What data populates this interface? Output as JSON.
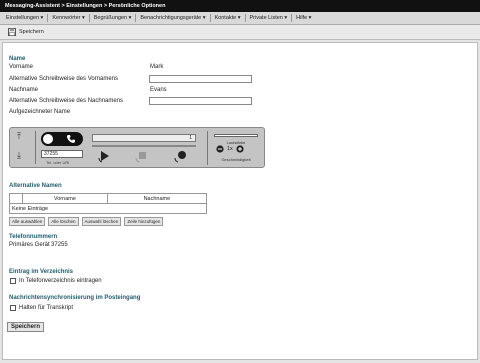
{
  "window": {
    "title": "Messaging-Assistent > Einstellungen > Persönliche Optionen"
  },
  "menu": [
    "Einstellungen ▾",
    "Kennwörter ▾",
    "Begrüßungen ▾",
    "Benachrichtigungsgeräte ▾",
    "Kontakte ▾",
    "Private Listen ▾",
    "Hilfe ▾"
  ],
  "toolbar": {
    "save_label": "Speichern"
  },
  "name_section": {
    "title": "Name",
    "first_name_label": "Vorname",
    "first_name_value": "Mark",
    "alt_first_label": "Alternative Schreibweise des Vornamens",
    "last_name_label": "Nachname",
    "last_name_value": "Evans",
    "alt_last_label": "Alternative Schreibweise des Nachnamens",
    "recorded_label": "Aufgezeichneter Name"
  },
  "recorder": {
    "arrow_up": "⤒",
    "arrow_down": "⤓",
    "extension_value": "37255",
    "caption": "Tel. oder URI",
    "counter": "1",
    "volume_label": "Lautstärke",
    "speed_value": "1x",
    "speed_label": "Geschwindigkeit"
  },
  "alt_names": {
    "title": "Alternative Namen",
    "columns": [
      "Vorname",
      "Nachname"
    ],
    "empty_text": "Keine Einträge",
    "buttons": [
      "Alle auswählen",
      "Alle löschen",
      "Auswahl löschen",
      "Zeile hinzufügen"
    ]
  },
  "phone_numbers": {
    "title": "Telefonnummern",
    "primary_label": "Primäres Gerät",
    "primary_value": "37255"
  },
  "directory": {
    "title": "Eintrag im Verzeichnis",
    "checkbox_label": "In Telefonverzeichnis eintragen"
  },
  "sync": {
    "title": "Nachrichtensynchronisierung im Posteingang",
    "checkbox_label": "Halten für Transkript"
  },
  "footer": {
    "save_label": "Speichern"
  }
}
